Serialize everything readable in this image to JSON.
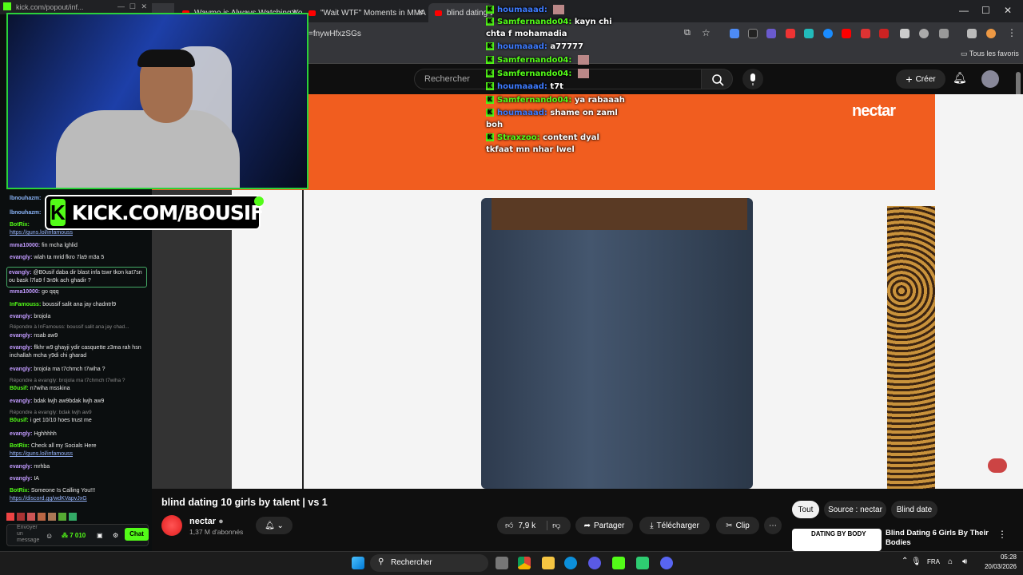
{
  "popout": {
    "url": "kick.com/popout/inf..."
  },
  "browser": {
    "tabs": [
      {
        "label": "Waymo is Always Watching Yo..."
      },
      {
        "label": "\"Wait WTF\" Moments in MMA"
      },
      {
        "label": "blind dating 10"
      }
    ],
    "url_fragment": "=fnywHfxzSGs",
    "bookmarks_label": "Tous les favoris",
    "colors": {
      "accent_red": "#ff0000"
    }
  },
  "overlay_chat": [
    {
      "user": "houmaaad:",
      "color": "blue",
      "text": ""
    },
    {
      "user": "Samfernando04:",
      "color": "green",
      "text": "kayn chi"
    },
    {
      "user": "",
      "color": "",
      "text": "chta f mohamadia"
    },
    {
      "user": "houmaaad:",
      "color": "blue",
      "text": "a77777"
    },
    {
      "user": "Samfernando04:",
      "color": "green",
      "text": ""
    },
    {
      "user": "Samfernando04:",
      "color": "green",
      "text": ""
    },
    {
      "user": "houmaaad:",
      "color": "blue",
      "text": "t7t"
    },
    {
      "user": "Samfernando04:",
      "color": "green",
      "text": "ya rabaaah"
    },
    {
      "user": "houmaaad:",
      "color": "blue",
      "text": "shame on zaml"
    },
    {
      "user": "",
      "color": "",
      "text": "boh"
    },
    {
      "user": "Straxzoo:",
      "color": "green",
      "text": "content dyal"
    },
    {
      "user": "",
      "color": "",
      "text": "tkfaat mn nhar lwel"
    }
  ],
  "kick_banner": {
    "text": "KICK.COM/BOUSIF",
    "logo": "K"
  },
  "left_chat": [
    {
      "user": "lbnouhazm:",
      "text": "",
      "color": "#8ab4f8"
    },
    {
      "user": "lbnouhazm:",
      "text": "",
      "color": "#8ab4f8"
    },
    {
      "user": "BotRix:",
      "text": "",
      "color": "#53fc18"
    },
    {
      "link": "https://guns.lol/infamouss"
    },
    {
      "user": "mma10000:",
      "text": "fin mcha lghlid",
      "color": "#c29bff"
    },
    {
      "user": "evangly:",
      "text": "wlah ta mrid fkro 7la9 m3a 5",
      "color": "#c29bff"
    },
    {
      "user": "evangly:",
      "text": "@B0usif daba dir blast infa tswr tkon kat7sn ou bask l7la9 f 3n9k ach ghadir ?",
      "color": "#c29bff"
    },
    {
      "user": "mma10000:",
      "text": "go qqq",
      "color": "#c29bff"
    },
    {
      "user": "InFamouss:",
      "text": "boussif salit ana jay chadntrl9",
      "color": "#53fc18"
    },
    {
      "user": "evangly:",
      "text": "brojola",
      "color": "#c29bff"
    },
    {
      "reply": "Répondre à InFamouss: boussif salit ana jay chad..."
    },
    {
      "user": "evangly:",
      "text": "nsab aw9",
      "color": "#c29bff"
    },
    {
      "user": "evangly:",
      "text": "flkhr w9 ghayji ydir casquette z3ma rah hsn inchallah mcha y9di chi gharad",
      "color": "#c29bff"
    },
    {
      "user": "evangly:",
      "text": "brojola ma t7chmch t7wiha ?",
      "color": "#c29bff"
    },
    {
      "reply": "Répondre à evangly: brojola ma t7chmch t7wiha ?"
    },
    {
      "user": "B0usif:",
      "text": "n7wiha msskina",
      "color": "#53fc18"
    },
    {
      "user": "evangly:",
      "text": "bdak lwjh aw9bdak lwjh aw9",
      "color": "#c29bff"
    },
    {
      "reply": "Répondre à evangly: bdak lwjh aw9"
    },
    {
      "user": "B0usif:",
      "text": "i get 10/10 hoes trust me",
      "color": "#53fc18"
    },
    {
      "user": "evangly:",
      "text": "Hghhhhh",
      "color": "#c29bff"
    },
    {
      "user": "BotRix:",
      "text": "Check all my Socials Here",
      "color": "#53fc18"
    },
    {
      "link": "https://guns.lol/infamouss"
    },
    {
      "user": "evangly:",
      "text": "mrhba",
      "color": "#c29bff"
    },
    {
      "user": "evangly:",
      "text": "IA",
      "color": "#c29bff"
    },
    {
      "user": "BotRix:",
      "text": "Someone Is Calling You!!!",
      "color": "#53fc18"
    },
    {
      "link": "https://discord.gg/wdKVapvJxG"
    }
  ],
  "chat_input": {
    "placeholder": "Envoyer un message",
    "points": "7 010",
    "send": "Chat"
  },
  "youtube": {
    "search_placeholder": "Rechercher",
    "create": "Créer",
    "brand_overlay": "nectar",
    "video_title": "blind dating 10 girls by talent | vs 1",
    "channel": "nectar",
    "subscribers": "1,37 M d'abonnés",
    "likes": "7,9 k",
    "share": "Partager",
    "download": "Télécharger",
    "clip": "Clip",
    "chips": [
      "Tout",
      "Source : nectar",
      "Blind date"
    ],
    "related": {
      "title": "Blind Dating 6 Girls By Their Bodies",
      "thumb_text": "DATING BY BODY"
    }
  },
  "taskbar": {
    "search": "Rechercher",
    "lang": "FRA",
    "time": "05:28",
    "date": "20/03/2026"
  }
}
